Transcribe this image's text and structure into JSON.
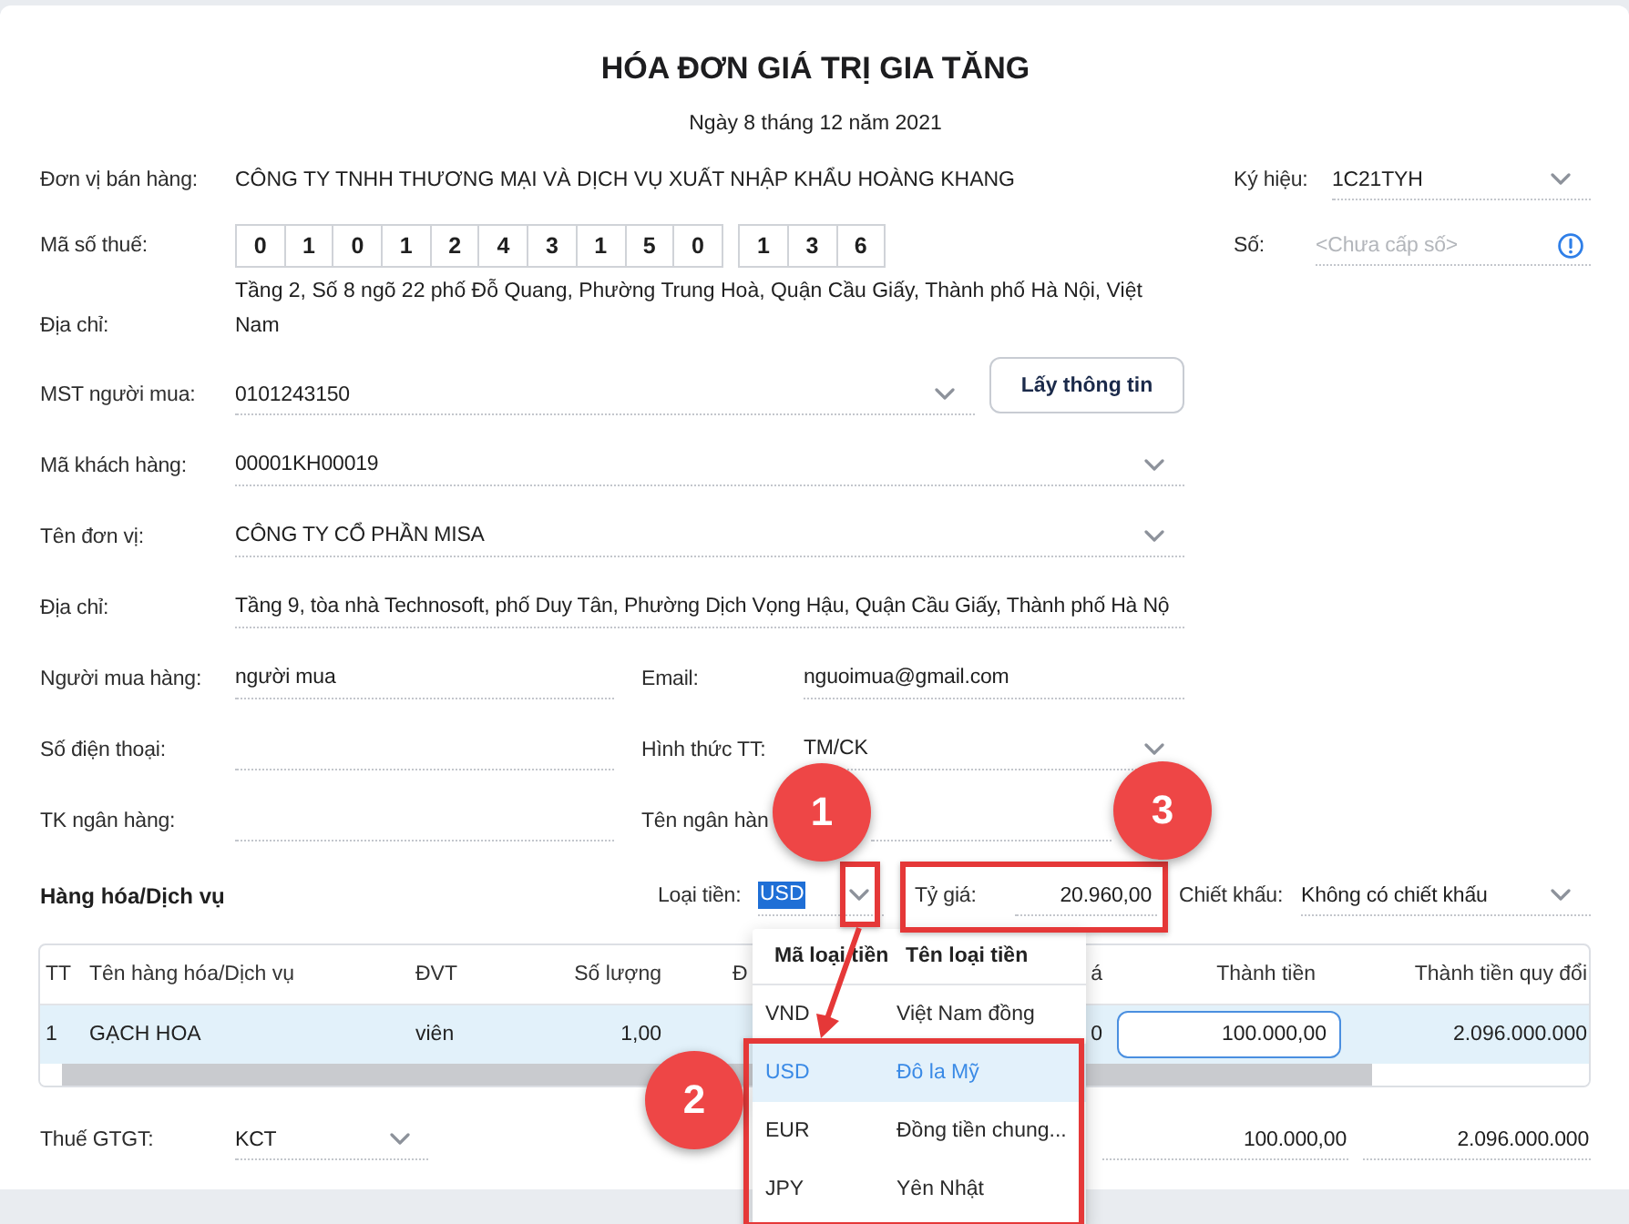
{
  "title": "HÓA ĐƠN GIÁ TRỊ GIA TĂNG",
  "date": "Ngày 8 tháng 12 năm 2021",
  "seller": {
    "name": {
      "label": "Đơn vị bán hàng:",
      "value": "CÔNG TY TNHH THƯƠNG MẠI VÀ DỊCH VỤ XUẤT NHẬP KHẨU HOÀNG KHANG"
    },
    "tax_code": {
      "label": "Mã số thuế:",
      "groups": [
        [
          "0",
          "1",
          "0",
          "1",
          "2",
          "4",
          "3",
          "1",
          "5",
          "0"
        ],
        [
          "1",
          "3",
          "6"
        ]
      ]
    },
    "address": {
      "label": "Địa chỉ:",
      "value": "Tầng 2, Số 8 ngõ 22 phố Đỗ Quang, Phường Trung Hoà, Quận Cầu Giấy, Thành phố Hà Nội, Việt Nam"
    }
  },
  "invoice_fields": [
    {
      "label": "Ký hiệu:",
      "value": "1C21TYH",
      "kind": "dropdown"
    },
    {
      "label": "Số:",
      "placeholder": "<Chưa cấp số>",
      "kind": "info"
    }
  ],
  "buyer_rows": [
    {
      "fields": [
        {
          "label": "MST người mua:",
          "value": "0101243150",
          "kind": "dropdown"
        }
      ],
      "button": "Lấy thông tin"
    },
    {
      "fields": [
        {
          "label": "Mã khách hàng:",
          "value": "00001KH00019",
          "kind": "dropdown"
        }
      ]
    },
    {
      "fields": [
        {
          "label": "Tên đơn vị:",
          "value": "CÔNG TY CỔ PHẦN MISA",
          "kind": "dropdown"
        }
      ]
    },
    {
      "fields": [
        {
          "label": "Địa chỉ:",
          "value": "Tầng 9, tòa nhà Technosoft, phố Duy Tân, Phường Dịch Vọng Hậu, Quận Cầu Giấy, Thành phố Hà Nộ",
          "kind": "text"
        }
      ]
    },
    {
      "fields": [
        {
          "label": "Người mua hàng:",
          "value": "người mua",
          "kind": "text"
        },
        {
          "label": "Email:",
          "value": "nguoimua@gmail.com",
          "kind": "text"
        }
      ]
    },
    {
      "fields": [
        {
          "label": "Số điện thoại:",
          "kind": "text"
        },
        {
          "label": "Hình thức TT:",
          "value": "TM/CK",
          "kind": "dropdown"
        }
      ]
    },
    {
      "fields": [
        {
          "label": "TK ngân hàng:",
          "kind": "text"
        },
        {
          "label": "Tên ngân hàn",
          "kind": "text"
        }
      ]
    }
  ],
  "goods": {
    "title": "Hàng hóa/Dịch vụ",
    "currency": {
      "label": "Loại tiền:",
      "value": "USD",
      "text_selected": true
    },
    "exchange_rate": {
      "label": "Tỷ giá:",
      "value": "20.960,00",
      "kind": "text"
    },
    "discount": {
      "label": "Chiết khấu:",
      "value": "Không có chiết khấu",
      "kind": "dropdown"
    }
  },
  "table": {
    "columns": [
      "TT",
      "Tên hàng hóa/Dịch vụ",
      "ĐVT",
      "Số lượng",
      "Đ",
      "á",
      "Thành tiền",
      "Thành tiền quy đổi"
    ],
    "rows": [
      {
        "selected": true,
        "cells": [
          {
            "text": "1",
            "kind": "text"
          },
          {
            "text": "GẠCH HOA",
            "kind": "text"
          },
          {
            "text": "viên",
            "kind": "text"
          },
          {
            "text": "1,00",
            "kind": "text"
          },
          null,
          {
            "text": "0",
            "kind": "text"
          },
          {
            "text": "100.000,00",
            "kind": "input"
          },
          {
            "text": "2.096.000.000",
            "kind": "text"
          }
        ]
      }
    ]
  },
  "vat": {
    "label": "Thuế GTGT:",
    "value": "KCT",
    "kind": "dropdown"
  },
  "totals": [
    {
      "value": "100.000,00",
      "kind": "text"
    },
    {
      "value": "2.096.000.000",
      "kind": "text"
    }
  ],
  "currency_menu": {
    "columns": [
      "Mã loại tiền",
      "Tên loại tiền"
    ],
    "options": [
      {
        "code": "VND",
        "name": "Việt Nam đồng",
        "selected": false
      },
      {
        "code": "USD",
        "name": "Đô la Mỹ",
        "selected": true
      },
      {
        "code": "EUR",
        "name": "Đồng tiền chung...",
        "selected": false
      },
      {
        "code": "JPY",
        "name": "Yên Nhật",
        "selected": false
      }
    ]
  },
  "annotations": [
    {
      "number": "1"
    },
    {
      "number": "2"
    },
    {
      "number": "3"
    }
  ]
}
